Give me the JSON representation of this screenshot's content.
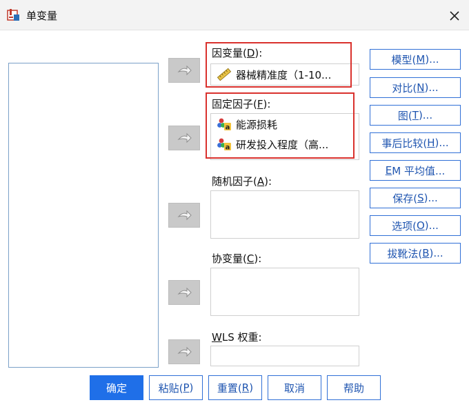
{
  "window": {
    "title": "单变量",
    "icon": "spss-dialog-icon",
    "close_icon": "close-icon"
  },
  "dependent": {
    "label_pre": "因变量(",
    "label_key": "D",
    "label_post": "):",
    "item": {
      "text": "器械精准度（1-10...",
      "icon": "ruler-scale-icon"
    }
  },
  "fixed": {
    "label_pre": "固定因子(",
    "label_key": "F",
    "label_post": "):",
    "items": [
      {
        "text": "能源损耗",
        "icon": "nominal-variable-icon"
      },
      {
        "text": "研发投入程度（高...",
        "icon": "nominal-variable-icon"
      }
    ]
  },
  "random": {
    "label_pre": "随机因子(",
    "label_key": "A",
    "label_post": "):"
  },
  "covariate": {
    "label_pre": "协变量(",
    "label_key": "C",
    "label_post": "):"
  },
  "wls": {
    "label_key": "W",
    "label_post": "LS 权重:"
  },
  "side_buttons": [
    {
      "pre": "模型(",
      "key": "M",
      "post": ")..."
    },
    {
      "pre": "对比(",
      "key": "N",
      "post": ")..."
    },
    {
      "pre": "图(",
      "key": "T",
      "post": ")..."
    },
    {
      "pre": "事后比较(",
      "key": "H",
      "post": ")..."
    },
    {
      "pre": "",
      "key": "E",
      "post": "M 平均值..."
    },
    {
      "pre": "保存(",
      "key": "S",
      "post": ")..."
    },
    {
      "pre": "选项(",
      "key": "O",
      "post": ")..."
    },
    {
      "pre": "拔靴法(",
      "key": "B",
      "post": ")..."
    }
  ],
  "bottom_buttons": {
    "ok": {
      "text": "确定"
    },
    "paste": {
      "pre": "粘贴(",
      "key": "P",
      "post": ")"
    },
    "reset": {
      "pre": "重置(",
      "key": "R",
      "post": ")"
    },
    "cancel": {
      "text": "取消"
    },
    "help": {
      "text": "帮助"
    }
  },
  "colors": {
    "accent": "#1f6fe8",
    "highlight_border": "#d9302c"
  }
}
